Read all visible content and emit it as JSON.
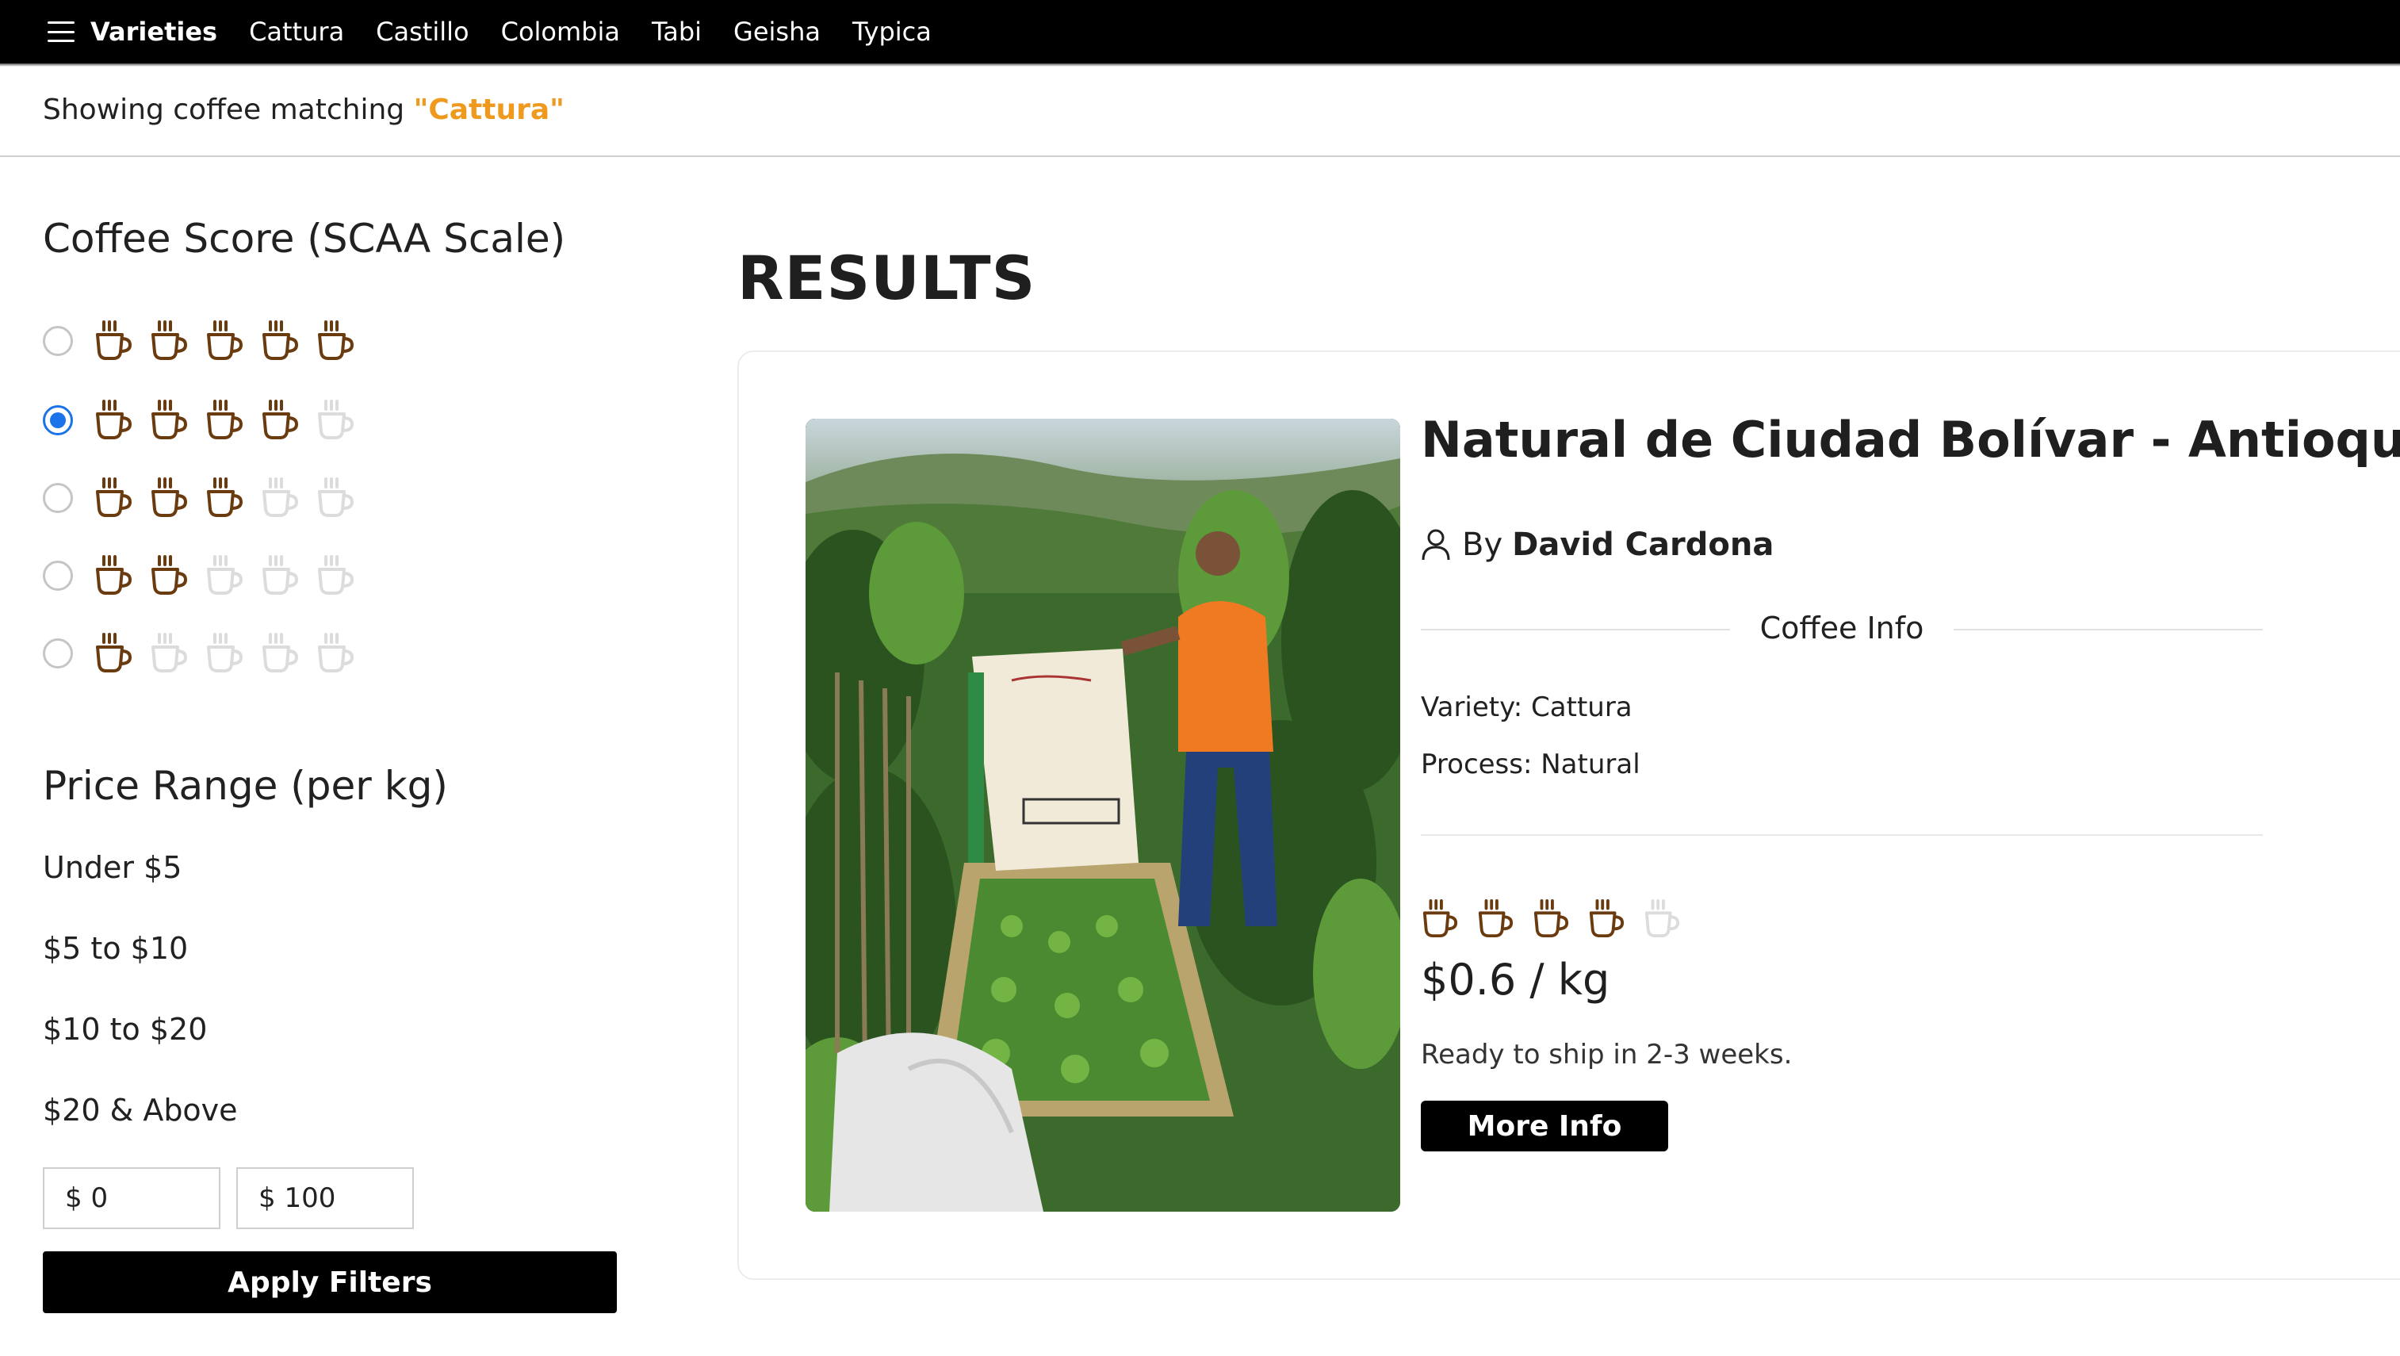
{
  "nav": {
    "brand": "Varieties",
    "items": [
      "Cattura",
      "Castillo",
      "Colombia",
      "Tabi",
      "Geisha",
      "Typica"
    ]
  },
  "status": {
    "prefix": "Showing coffee matching ",
    "term": "\"Cattura\""
  },
  "sidebar": {
    "score_title": "Coffee Score (SCAA Scale)",
    "score_options": [
      {
        "cups": 5,
        "selected": false
      },
      {
        "cups": 4,
        "selected": true
      },
      {
        "cups": 3,
        "selected": false
      },
      {
        "cups": 2,
        "selected": false
      },
      {
        "cups": 1,
        "selected": false
      }
    ],
    "price_title": "Price Range (per kg)",
    "price_options": [
      "Under $5",
      "$5 to $10",
      "$10 to $20",
      "$20 & Above"
    ],
    "min_value": "$ 0",
    "max_value": "$ 100",
    "apply_label": "Apply Filters"
  },
  "results": {
    "heading": "RESULTS",
    "item": {
      "name": "Natural de Ciudad Bolívar - Antioquia",
      "by_label": "By",
      "author": "David Cardona",
      "info_label": "Coffee Info",
      "variety": "Variety: Cattura",
      "process": "Process: Natural",
      "score_cups": 4,
      "price": "$0.6 / kg",
      "shipping": "Ready to ship in 2-3 weeks.",
      "more_label": "More Info"
    }
  },
  "colors": {
    "accent": "#ee9a1f",
    "cup_on": "#6b3b10",
    "cup_off": "#dcdcdc",
    "radio_selected": "#1a73e8"
  }
}
